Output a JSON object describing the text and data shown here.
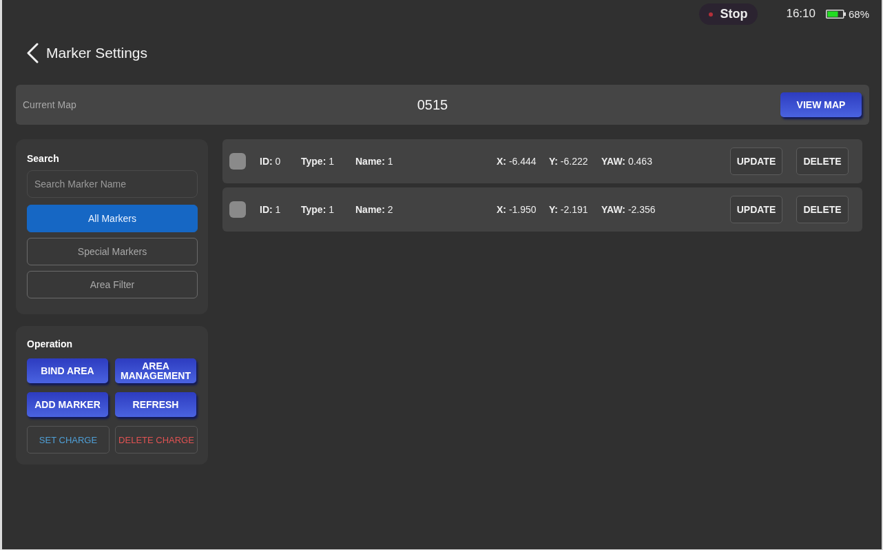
{
  "status_bar": {
    "stop_button": "Stop",
    "time": "16:10",
    "battery": "68%"
  },
  "header": {
    "title": "Marker Settings"
  },
  "current_map": {
    "label": "Current Map",
    "value": "0515",
    "button": "VIEW MAP"
  },
  "search_panel": {
    "title": "Search",
    "search": {
      "placeholder": "Search Marker Name"
    },
    "filters": [
      {
        "label": "All Markers",
        "selected": true
      },
      {
        "label": "Special Markers",
        "selected": false
      },
      {
        "label": "Area Filter",
        "selected": false
      }
    ]
  },
  "operation_panel": {
    "title": "Operation",
    "buttons": [
      {
        "label": "BIND AREA",
        "kind": "primary"
      },
      {
        "label": "AREA MANAGEMENT",
        "kind": "primary"
      },
      {
        "label": "ADD MARKER",
        "kind": "primary"
      },
      {
        "label": "REFRESH",
        "kind": "primary"
      },
      {
        "label": "SET CHARGE",
        "kind": "info"
      },
      {
        "label": "DELETE CHARGE",
        "kind": "danger"
      }
    ]
  },
  "markers": [
    {
      "checked": false,
      "fields": [
        {
          "label": "ID:",
          "value": "0"
        },
        {
          "label": "Type:",
          "value": "1"
        },
        {
          "label": "Name:",
          "value": "1"
        },
        {
          "label": "X:",
          "value": "-6.444"
        },
        {
          "label": "Y:",
          "value": "-6.222"
        },
        {
          "label": "YAW:",
          "value": "0.463"
        }
      ],
      "buttons": [
        "UPDATE",
        "DELETE"
      ]
    },
    {
      "checked": false,
      "fields": [
        {
          "label": "ID:",
          "value": "1"
        },
        {
          "label": "Type:",
          "value": "1"
        },
        {
          "label": "Name:",
          "value": "2"
        },
        {
          "label": "X:",
          "value": "-1.950"
        },
        {
          "label": "Y:",
          "value": "-2.191"
        },
        {
          "label": "YAW:",
          "value": "-2.356"
        }
      ],
      "buttons": [
        "UPDATE",
        "DELETE"
      ]
    }
  ]
}
